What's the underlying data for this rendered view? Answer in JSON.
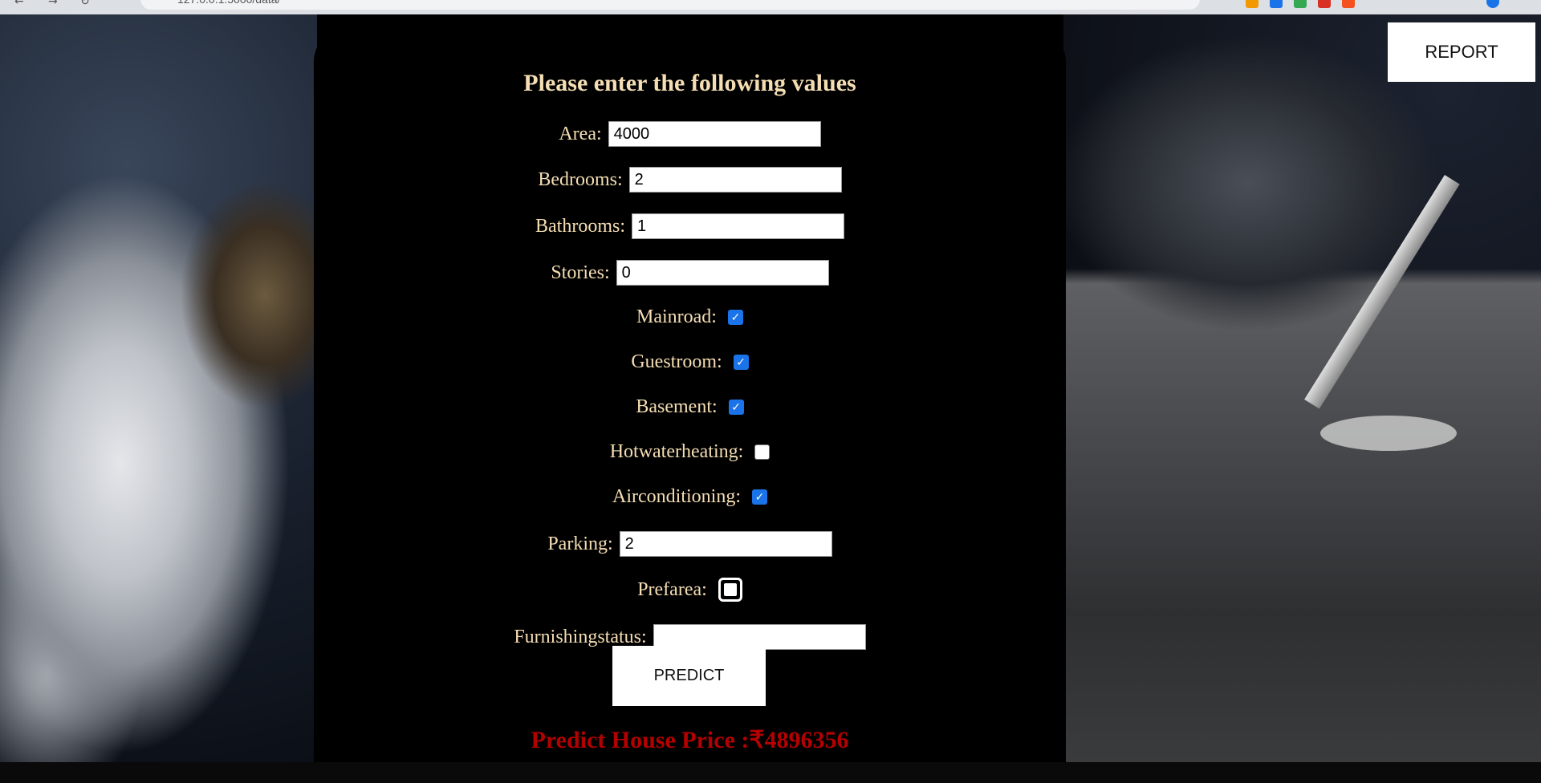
{
  "browser": {
    "url": "127.0.0.1:5000/data/",
    "nav_icons": [
      "back-icon",
      "forward-icon",
      "reload-icon"
    ],
    "extension_colors": [
      "#f29900",
      "#1a73e8",
      "#34a853",
      "#d93025",
      "#f4511e",
      "#8e24aa"
    ]
  },
  "header": {
    "report_label": "REPORT"
  },
  "form": {
    "title": "Please enter the following values",
    "area": {
      "label": "Area:",
      "value": "4000"
    },
    "bedrooms": {
      "label": "Bedrooms:",
      "value": "2"
    },
    "bathrooms": {
      "label": "Bathrooms:",
      "value": "1"
    },
    "stories": {
      "label": "Stories:",
      "value": "0"
    },
    "mainroad": {
      "label": "Mainroad:",
      "checked": true
    },
    "guestroom": {
      "label": "Guestroom:",
      "checked": true
    },
    "basement": {
      "label": "Basement:",
      "checked": true
    },
    "hotwaterheating": {
      "label": "Hotwaterheating:",
      "checked": false
    },
    "airconditioning": {
      "label": "Airconditioning:",
      "checked": true
    },
    "parking": {
      "label": "Parking:",
      "value": "2"
    },
    "prefarea": {
      "label": "Prefarea:",
      "checked": false
    },
    "furnishingstatus": {
      "label": "Furnishingstatus:",
      "value": ""
    },
    "predict_label": "PREDICT"
  },
  "result": {
    "text": "Predict House Price :₹4896356"
  },
  "colors": {
    "label_color": "#f5deb3",
    "result_color": "#b30000",
    "checkbox_accent": "#1a73e8"
  }
}
